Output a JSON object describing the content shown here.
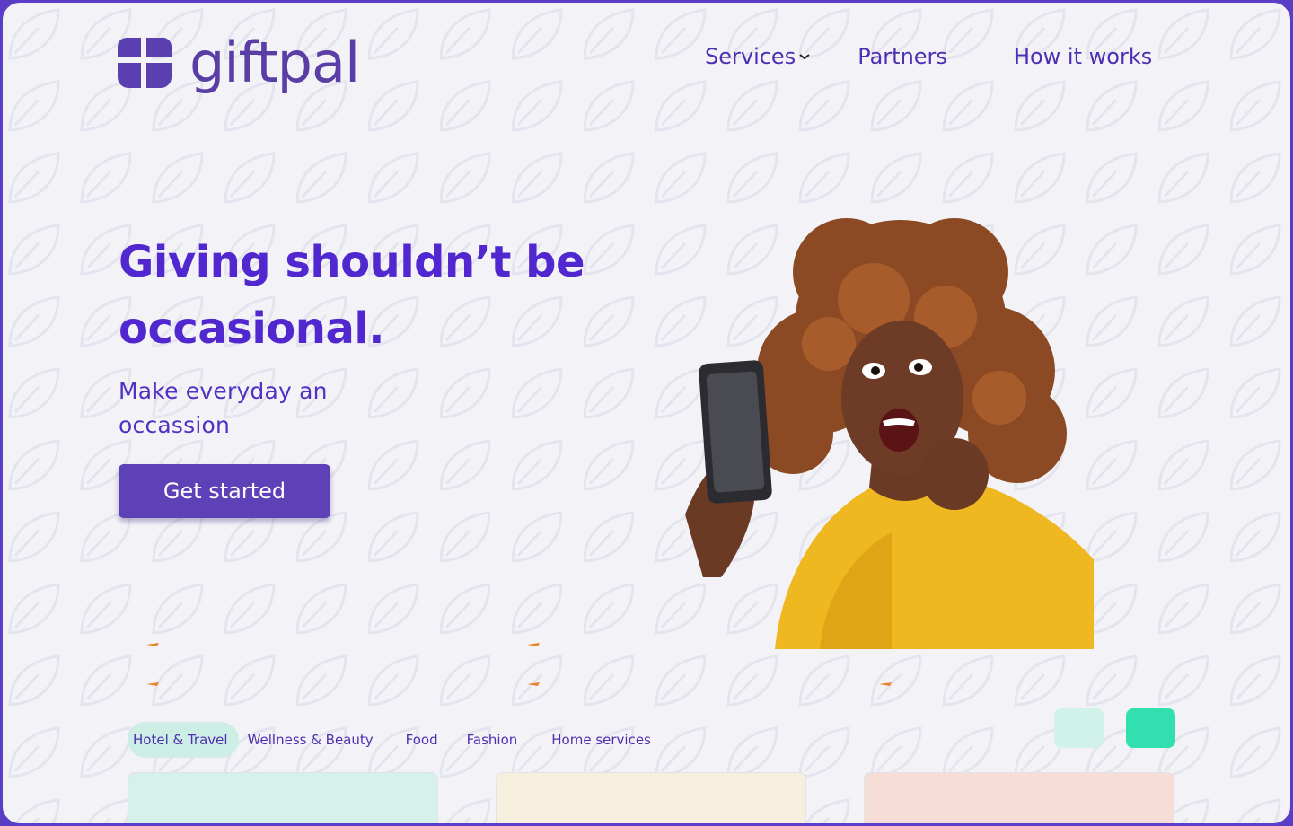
{
  "brand": {
    "name": "giftpal",
    "color": "#5a3ea6"
  },
  "nav": {
    "services": "Services",
    "partners": "Partners",
    "how_it_works": "How it works"
  },
  "hero": {
    "title": "Giving shouldn’t be occasional.",
    "subtitle": "Make everyday an occassion",
    "cta": "Get started",
    "image_alt": "Excited woman looking at her phone"
  },
  "categories": {
    "tabs": [
      "Hotel & Travel",
      "Wellness & Beauty",
      "Food",
      "Fashion",
      "Home services"
    ],
    "active": "Hotel & Travel"
  },
  "colors": {
    "primary": "#5127cf",
    "button": "#5e40b7",
    "accent": "#32dfae",
    "accent_light": "#d0f2e8"
  },
  "icons": {
    "dropdown": "chevron-down-icon",
    "prev": "arrow-left-icon",
    "next": "arrow-right-icon"
  }
}
